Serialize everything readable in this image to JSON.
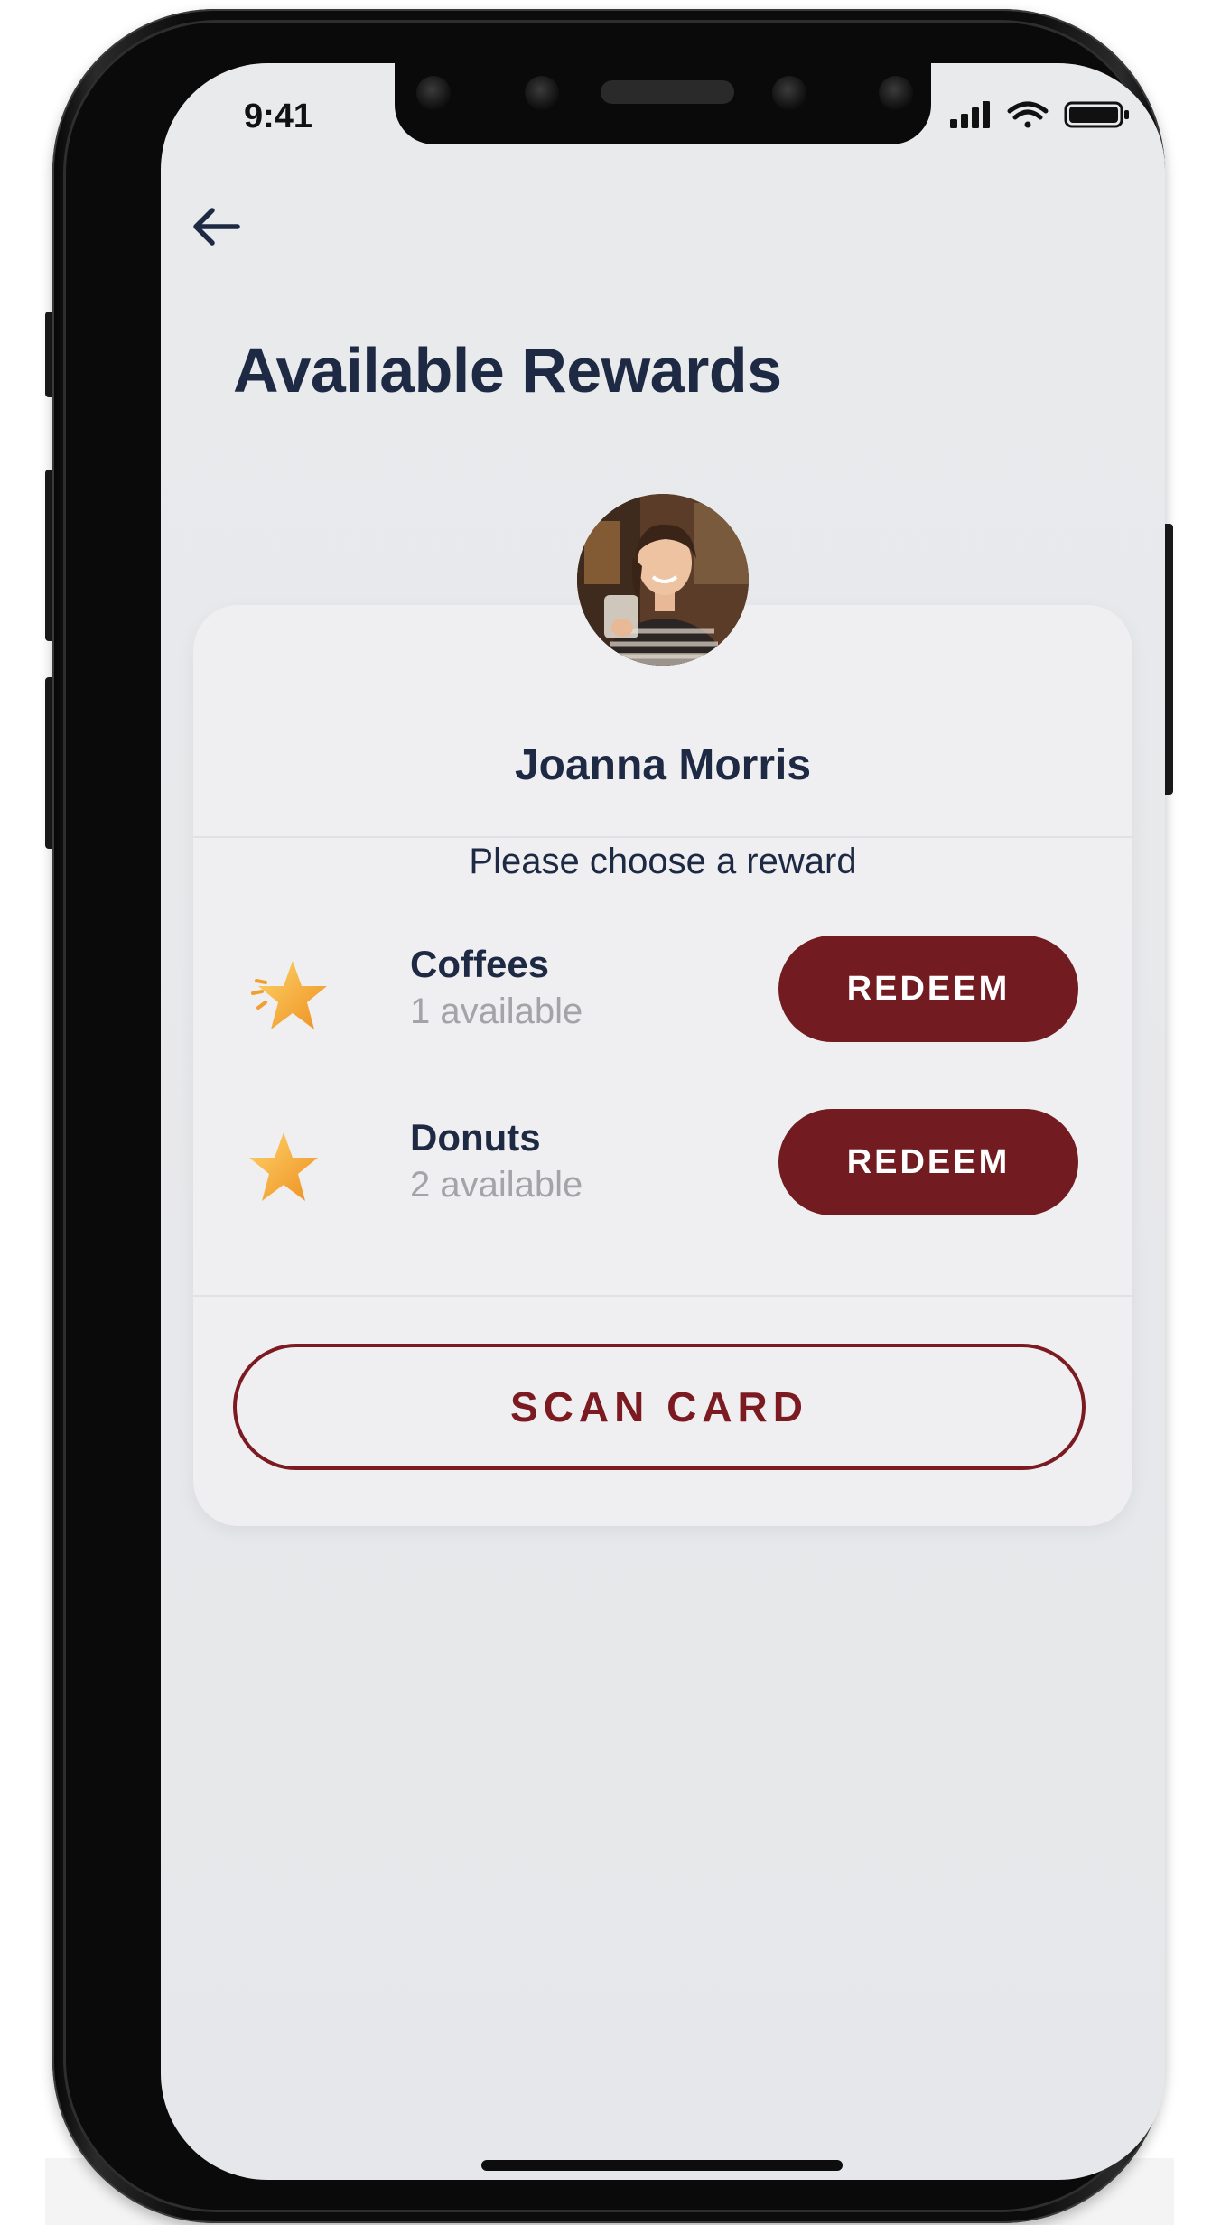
{
  "status_bar": {
    "time": "9:41"
  },
  "header": {
    "back_icon": "arrow-left-icon",
    "title": "Available Rewards"
  },
  "profile": {
    "name": "Joanna Morris"
  },
  "rewards": {
    "prompt": "Please choose a reward",
    "items": [
      {
        "name": "Coffees",
        "availability": "1 available",
        "action": "REDEEM",
        "icon": "star-icon"
      },
      {
        "name": "Donuts",
        "availability": "2 available",
        "action": "REDEEM",
        "icon": "star-icon"
      }
    ]
  },
  "scan_button": {
    "label": "SCAN CARD"
  },
  "colors": {
    "brand_red": "#721b21",
    "title_navy": "#1e2a44",
    "star_gold": "#f3a93a",
    "muted_text": "#a3a3a8",
    "screen_bg": "#e8e9eb"
  }
}
